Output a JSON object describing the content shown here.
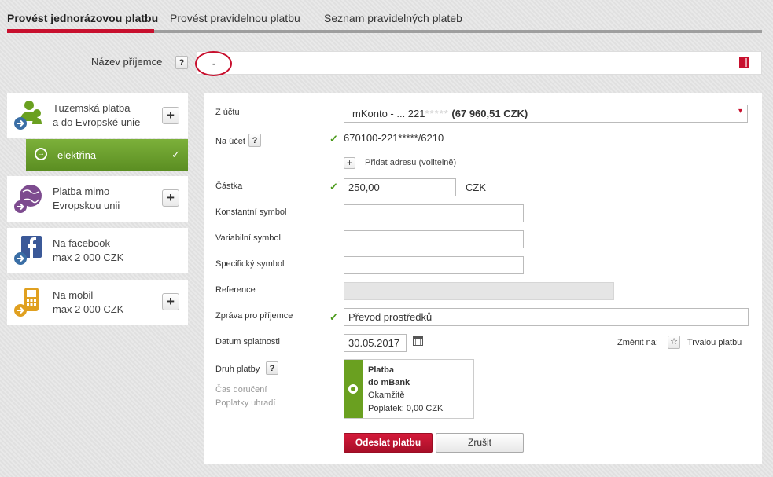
{
  "tabs": [
    {
      "label": "Provést jednorázovou platbu",
      "active": true
    },
    {
      "label": "Provést pravidelnou platbu",
      "active": false
    },
    {
      "label": "Seznam pravidelných plateb",
      "active": false
    }
  ],
  "recipient": {
    "label": "Název příjemce",
    "help": "?",
    "value": "-"
  },
  "payment_types": [
    {
      "line1": "Tuzemská platba",
      "line2": "a do Evropské unie",
      "icon": "person-arrow-icon",
      "action": "+"
    },
    {
      "line1": "Platba mimo",
      "line2": "Evropskou unii",
      "icon": "globe-arrow-icon",
      "action": "+"
    },
    {
      "line1": "Na facebook",
      "line2": "max 2 000 CZK",
      "icon": "facebook-arrow-icon"
    },
    {
      "line1": "Na mobil",
      "line2": "max 2 000 CZK",
      "icon": "mobile-arrow-icon",
      "action": "+"
    }
  ],
  "selected_template": {
    "label": "elektřina",
    "check": "✓"
  },
  "form": {
    "from_account": {
      "label": "Z účtu",
      "value_prefix": "mKonto - ... 221",
      "value_masked": "*****",
      "balance": "(67 960,51 CZK)",
      "chevron": "▾"
    },
    "to_account": {
      "label": "Na účet",
      "help": "?",
      "value": "670100-221*****/6210"
    },
    "add_address": {
      "icon": "+",
      "label": "Přidat adresu (volitelně)"
    },
    "amount": {
      "label": "Částka",
      "value": "250,00",
      "currency": "CZK"
    },
    "constant_symbol": {
      "label": "Konstantní symbol",
      "value": ""
    },
    "variable_symbol": {
      "label": "Variabilní symbol",
      "value": ""
    },
    "specific_symbol": {
      "label": "Specifický symbol",
      "value": ""
    },
    "reference": {
      "label": "Reference",
      "value": ""
    },
    "message": {
      "label": "Zpráva pro příjemce",
      "value": "Převod prostředků"
    },
    "due_date": {
      "label": "Datum splatnosti",
      "value": "30.05.2017"
    },
    "change_to": {
      "label": "Změnit na:",
      "link": "Trvalou platbu"
    },
    "payment_kind": {
      "label": "Druh platby",
      "help": "?",
      "delivery_label": "Čas doručení",
      "fees_label": "Poplatky uhradí"
    },
    "payment_tile": {
      "title1": "Platba",
      "title2": "do mBank",
      "delivery": "Okamžitě",
      "fee": "Poplatek: 0,00 CZK"
    },
    "tick": "✓"
  },
  "buttons": {
    "send": "Odeslat platbu",
    "cancel": "Zrušit"
  },
  "colors": {
    "accent": "#c8102e",
    "green": "#6aa020"
  }
}
